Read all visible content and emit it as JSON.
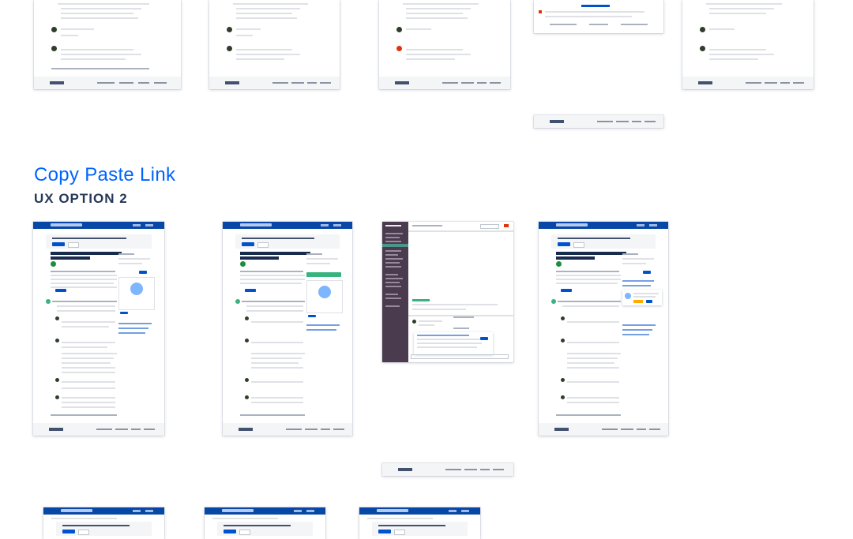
{
  "section": {
    "title": "Copy Paste Link",
    "subtitle": "UX OPTION 2"
  },
  "colors": {
    "accent": "#0065ff",
    "header_blue": "#0747a6",
    "button_blue": "#0052cc",
    "heading_dark": "#253858",
    "slack_sidebar": "#4a3b4e"
  },
  "thumbnails": {
    "top_row": [
      "community-thread-1",
      "community-thread-2",
      "community-thread-3",
      "slack-unfurl-preview",
      "community-thread-5"
    ],
    "middle_row": [
      "community-question-page-1",
      "community-question-page-2",
      "slack-channel-message",
      "community-question-page-4"
    ],
    "bottom_row": [
      "community-page-partial-1",
      "community-page-partial-2",
      "community-page-partial-3"
    ]
  }
}
